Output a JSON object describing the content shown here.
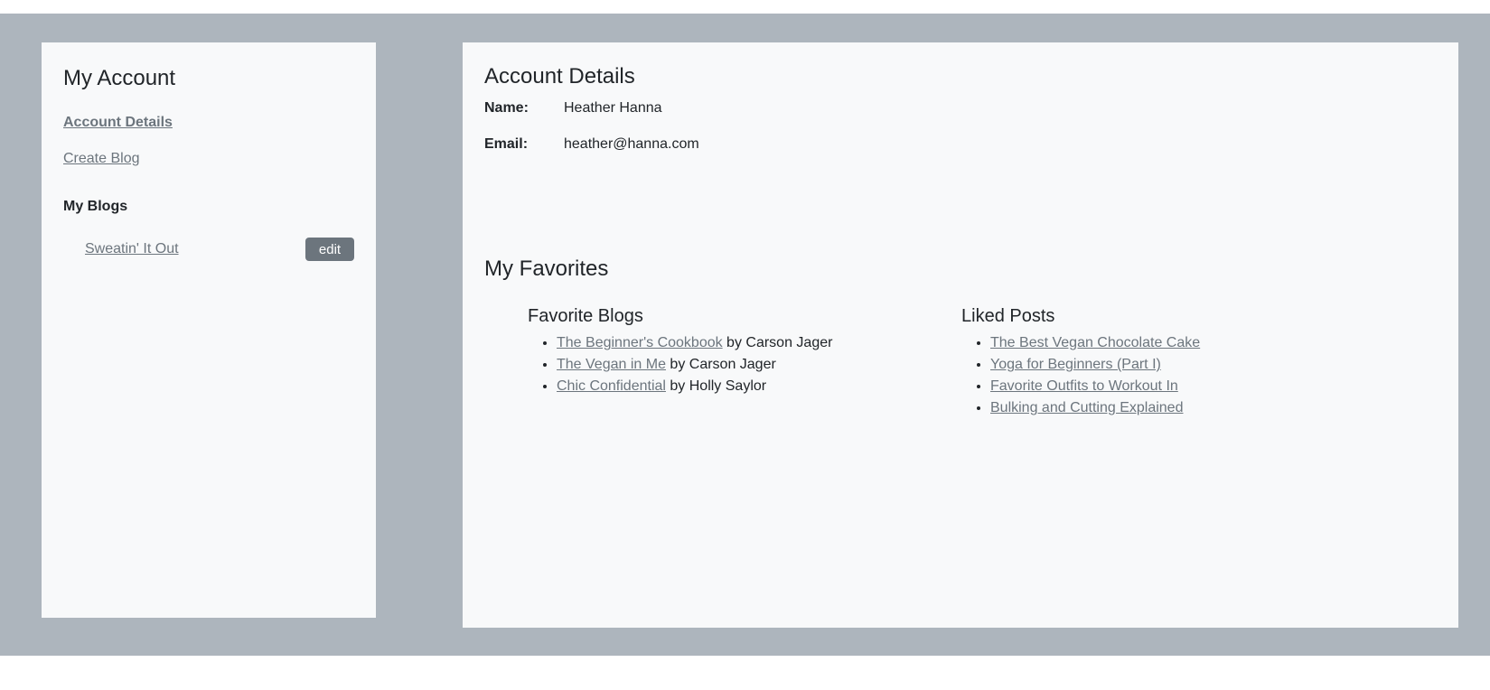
{
  "sidebar": {
    "title": "My Account",
    "nav": {
      "account_details": "Account Details",
      "create_blog": "Create Blog"
    },
    "my_blogs_label": "My Blogs",
    "blogs": [
      {
        "title": "Sweatin' It Out",
        "edit_label": "edit"
      }
    ]
  },
  "main": {
    "details_title": "Account Details",
    "name_label": "Name:",
    "name_value": "Heather Hanna",
    "email_label": "Email:",
    "email_value": "heather@hanna.com",
    "favorites_title": "My Favorites",
    "favorite_blogs": {
      "heading": "Favorite Blogs",
      "items": [
        {
          "title": "The Beginner's Cookbook",
          "byline": " by Carson Jager"
        },
        {
          "title": "The Vegan in Me",
          "byline": " by Carson Jager"
        },
        {
          "title": "Chic Confidential",
          "byline": " by Holly Saylor"
        }
      ]
    },
    "liked_posts": {
      "heading": "Liked Posts",
      "items": [
        "The Best Vegan Chocolate Cake",
        "Yoga for Beginners (Part I)",
        "Favorite Outfits to Workout In",
        "Bulking and Cutting Explained"
      ]
    }
  },
  "colors": {
    "backdrop": "#adb5bd",
    "panel": "#f8f9fa",
    "link": "#6c757d",
    "button": "#6c757d"
  }
}
